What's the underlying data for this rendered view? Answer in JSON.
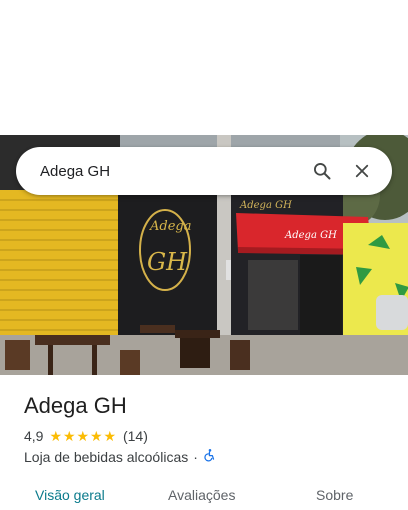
{
  "search": {
    "query": "Adega GH"
  },
  "icons": {
    "search": "search-icon",
    "close": "close-icon",
    "accessibility": "wheelchair-icon",
    "star": "star-icon"
  },
  "photo": {
    "signs": {
      "adega": "Adega",
      "gh": "GH",
      "awning": "Adega GH"
    }
  },
  "place": {
    "name": "Adega GH",
    "rating": "4,9",
    "stars": 5,
    "reviews": "(14)",
    "category": "Loja de bebidas alcoólicas",
    "separator": "·"
  },
  "tabs": [
    {
      "label": "Visão geral",
      "active": true
    },
    {
      "label": "Avaliações",
      "active": false
    },
    {
      "label": "Sobre",
      "active": false
    }
  ],
  "colors": {
    "accent": "#0b7b8c",
    "star": "#fbbc04",
    "accessibility": "#1a73e8"
  }
}
